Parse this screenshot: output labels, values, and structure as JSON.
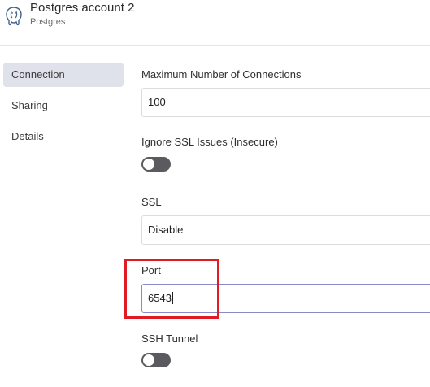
{
  "header": {
    "title": "Postgres account 2",
    "subtitle": "Postgres"
  },
  "sidebar": {
    "items": [
      {
        "label": "Connection",
        "active": true
      },
      {
        "label": "Sharing",
        "active": false
      },
      {
        "label": "Details",
        "active": false
      }
    ]
  },
  "form": {
    "max_connections": {
      "label": "Maximum Number of Connections",
      "value": "100"
    },
    "ignore_ssl": {
      "label": "Ignore SSL Issues (Insecure)",
      "enabled": false
    },
    "ssl": {
      "label": "SSL",
      "value": "Disable"
    },
    "port": {
      "label": "Port",
      "value": "6543"
    },
    "ssh_tunnel": {
      "label": "SSH Tunnel",
      "enabled": false
    }
  },
  "colors": {
    "highlight": "#e01b24",
    "active_nav": "#dfe1eb",
    "toggle_off": "#5a5a5f",
    "focus_border": "#8a8ac6"
  }
}
